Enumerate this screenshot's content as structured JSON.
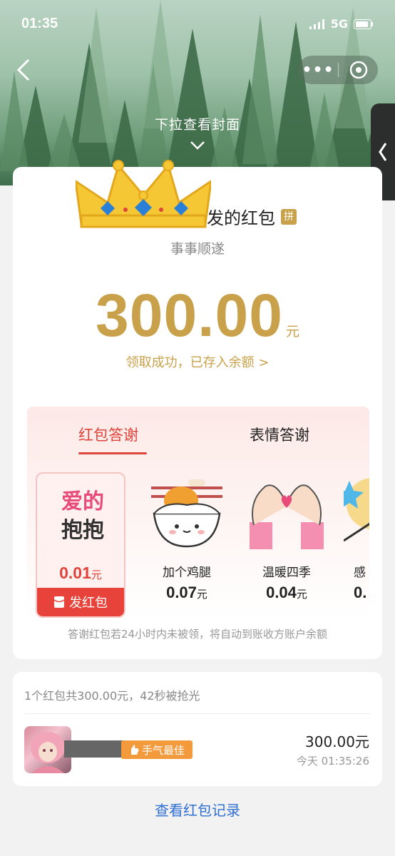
{
  "status_bar": {
    "time": "01:35",
    "network": "5G"
  },
  "header": {
    "pull_hint": "下拉查看封面"
  },
  "envelope": {
    "sender_title": "发的红包",
    "pin_badge": "拼",
    "blessing": "事事顺遂",
    "amount": "300.00",
    "currency": "元",
    "received_text": "领取成功，已存入余额 >"
  },
  "thanks_panel": {
    "tabs": [
      {
        "label": "红包答谢"
      },
      {
        "label": "表情答谢"
      }
    ],
    "gifts": [
      {
        "sticker_line1": "爱的",
        "sticker_line2": "抱抱",
        "price": "0.01",
        "unit": "元",
        "action": "发红包"
      },
      {
        "name": "加个鸡腿",
        "price": "0.07",
        "unit": "元"
      },
      {
        "name": "温暖四季",
        "price": "0.04",
        "unit": "元"
      },
      {
        "name": "感",
        "price": "0.",
        "unit": ""
      }
    ],
    "notice": "答谢红包若24小时内未被领，将自动到账收方账户余额"
  },
  "record": {
    "summary": "1个红包共300.00元，42秒被抢光",
    "badge": "手气最佳",
    "amount": "300.00元",
    "time": "今天 01:35:26"
  },
  "footer": {
    "link": "查看红包记录"
  },
  "colors": {
    "gold": "#c9a14a",
    "red": "#e0433a",
    "link_blue": "#2f6fd4",
    "badge_orange": "#f39a3c"
  }
}
